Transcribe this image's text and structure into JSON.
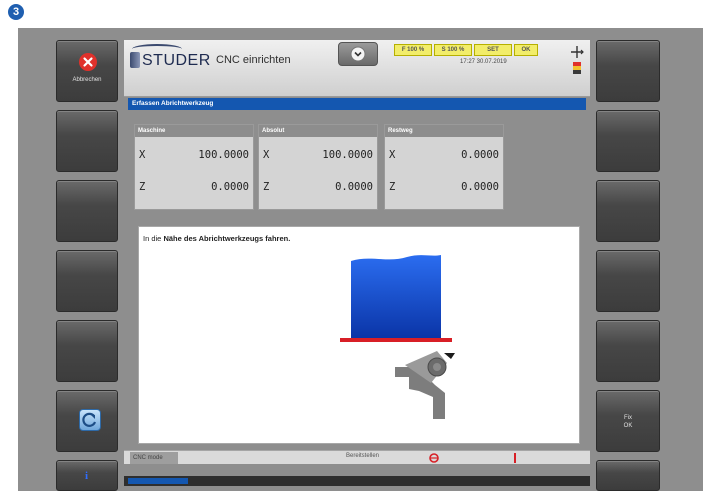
{
  "step_number": "3",
  "left_softkeys": {
    "abort_label": "Abbrechen",
    "info_label": "i"
  },
  "right_softkeys": {
    "fix_label_line1": "Fix",
    "fix_label_line2": "OK"
  },
  "header": {
    "brand": "STUDER",
    "title": "CNC einrichten",
    "status": [
      "F 100 %",
      "S 100 %",
      "SET",
      "OK"
    ],
    "datetime": "17:27 30.07.2019"
  },
  "title_bar": "Erfassen Abrichtwerkzeug",
  "panels": [
    {
      "title": "Maschine",
      "rows": [
        {
          "axis": "X",
          "value": "100.0000"
        },
        {
          "axis": "Z",
          "value": "0.0000"
        }
      ]
    },
    {
      "title": "Absolut",
      "rows": [
        {
          "axis": "X",
          "value": "100.0000"
        },
        {
          "axis": "Z",
          "value": "0.0000"
        }
      ]
    },
    {
      "title": "Restweg",
      "rows": [
        {
          "axis": "X",
          "value": "0.0000"
        },
        {
          "axis": "Z",
          "value": "0.0000"
        }
      ]
    }
  ],
  "instruction": {
    "prefix": "In die ",
    "bold": "Nähe des Abrichtwerkzeugs fahren."
  },
  "footer": {
    "tab_label": "CNC mode",
    "status_text": "Bereitstellen"
  },
  "colors": {
    "accent": "#1457b0",
    "status_yellow": "#f2ed6a",
    "grinding_wheel_blue": "#1a5cd6",
    "abort_red": "#e0312b",
    "tool_grey": "#7d7d7d"
  },
  "icons": {
    "abort": "close-x-icon",
    "refresh": "refresh-icon",
    "collapse": "chevron-down-icon",
    "info": "info-icon"
  }
}
